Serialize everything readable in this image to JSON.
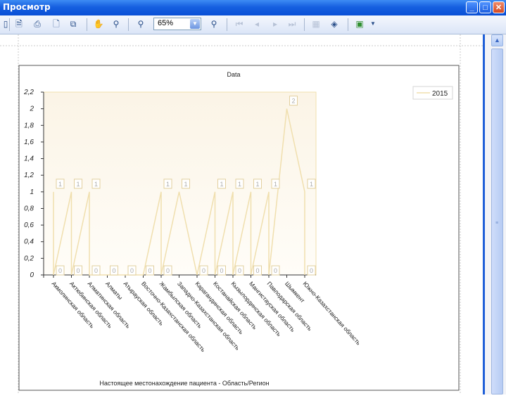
{
  "window": {
    "title": "Просмотр"
  },
  "toolbar": {
    "zoom_value": "65%"
  },
  "report": {
    "x_axis_title": "Настоящее местонахождение пациента - Область/Регион"
  },
  "chart_data": {
    "type": "line",
    "title": "Data",
    "xlabel": "Настоящее местонахождение пациента - Область/Регион",
    "ylabel": "",
    "ylim": [
      0,
      2.2
    ],
    "y_ticks": [
      "0",
      "0,2",
      "0,4",
      "0,6",
      "0,8",
      "1",
      "1,2",
      "1,4",
      "1,6",
      "1,8",
      "2",
      "2,2"
    ],
    "legend": "top-right",
    "categories": [
      "Акмолинская область",
      "Актюбинская область",
      "Алматинская область",
      "Алматы",
      "Атырауская область",
      "Восточно-Казахстанская область",
      "Жамбылская область",
      "Западно-Казахстанская область",
      "Карагандинская область",
      "Костанайская область",
      "Кызылординская область",
      "Мангистауская область",
      "Павлодарская область",
      "Шымкент",
      "Южно-Казахстанская область"
    ],
    "series": [
      {
        "name": "2015",
        "points": [
          {
            "x": 0,
            "y": 1
          },
          {
            "x": 0,
            "y": 0
          },
          {
            "x": 1,
            "y": 1
          },
          {
            "x": 1,
            "y": 0
          },
          {
            "x": 2,
            "y": 1
          },
          {
            "x": 2,
            "y": 0
          },
          {
            "x": 3,
            "y": 0
          },
          {
            "x": 4,
            "y": 0
          },
          {
            "x": 5,
            "y": 0
          },
          {
            "x": 6,
            "y": 1
          },
          {
            "x": 6,
            "y": 0
          },
          {
            "x": 7,
            "y": 1
          },
          {
            "x": 8,
            "y": 0
          },
          {
            "x": 9,
            "y": 1
          },
          {
            "x": 9,
            "y": 0
          },
          {
            "x": 10,
            "y": 1
          },
          {
            "x": 10,
            "y": 0
          },
          {
            "x": 11,
            "y": 1
          },
          {
            "x": 11,
            "y": 0
          },
          {
            "x": 12,
            "y": 1
          },
          {
            "x": 12,
            "y": 0
          },
          {
            "x": 13,
            "y": 2
          },
          {
            "x": 14,
            "y": 1
          },
          {
            "x": 14,
            "y": 0
          }
        ]
      }
    ],
    "colors": {
      "line": "#f0dfae",
      "plot_bg_top": "#fbf4e6",
      "plot_bg_bottom": "#fffdf8"
    }
  }
}
